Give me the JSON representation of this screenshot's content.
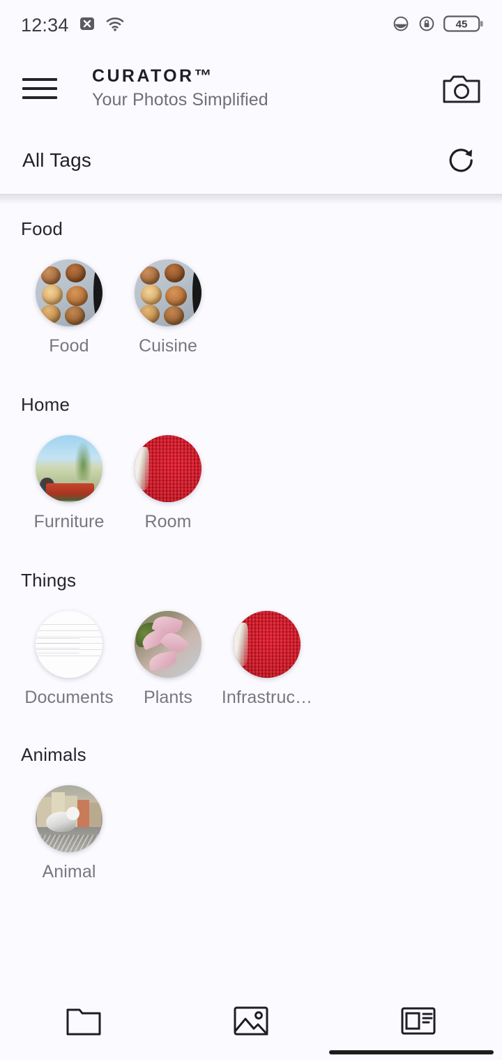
{
  "status_bar": {
    "time": "12:34",
    "icons_left": [
      "no-sim-x-icon",
      "wifi-icon"
    ],
    "icons_right": [
      "dark-theme-icon",
      "rotation-lock-icon"
    ],
    "battery_level": "45"
  },
  "app_bar": {
    "menu_icon": "hamburger-menu-icon",
    "title": "CURATOR™",
    "subtitle": "Your Photos Simplified",
    "camera_icon": "camera-icon"
  },
  "tags_bar": {
    "title": "All Tags",
    "refresh_icon": "refresh-icon"
  },
  "sections": [
    {
      "title": "Food",
      "items": [
        {
          "label": "Food",
          "art": "art-muffin"
        },
        {
          "label": "Cuisine",
          "art": "art-muffin"
        }
      ]
    },
    {
      "title": "Home",
      "items": [
        {
          "label": "Furniture",
          "art": "art-field"
        },
        {
          "label": "Room",
          "art": "art-knit"
        }
      ]
    },
    {
      "title": "Things",
      "items": [
        {
          "label": "Documents",
          "art": "art-doc"
        },
        {
          "label": "Plants",
          "art": "art-plant"
        },
        {
          "label": "Infrastruc…",
          "art": "art-knit"
        }
      ]
    },
    {
      "title": "Animals",
      "items": [
        {
          "label": "Animal",
          "art": "art-bird"
        }
      ]
    }
  ],
  "bottom_nav": [
    {
      "icon": "folder-icon",
      "active": false
    },
    {
      "icon": "gallery-image-icon",
      "active": false
    },
    {
      "icon": "article-card-icon",
      "active": false
    }
  ],
  "colors": {
    "background": "#fbfaff",
    "text_primary": "#1f1f27",
    "text_secondary": "#77777f",
    "accent_red": "#d3101f",
    "icon_dark": "#23232b"
  }
}
